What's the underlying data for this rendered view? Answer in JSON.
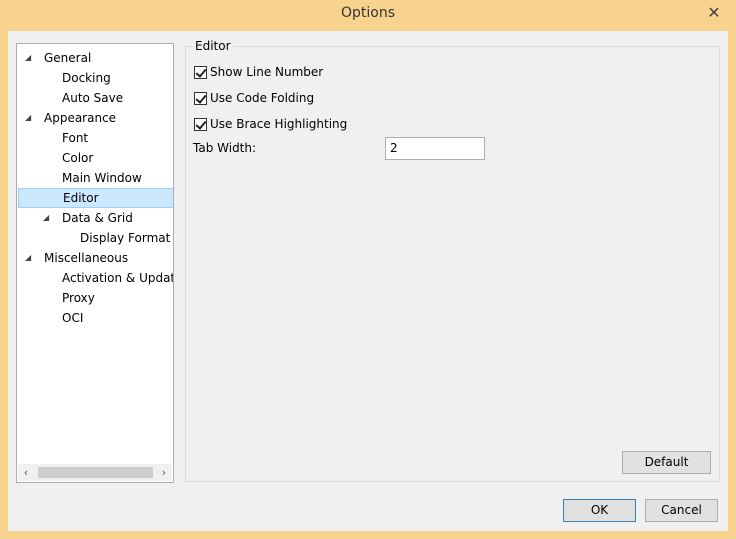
{
  "window": {
    "title": "Options"
  },
  "tree": {
    "items": [
      {
        "label": "General",
        "expanded": true,
        "level": 0
      },
      {
        "label": "Docking",
        "level": 1
      },
      {
        "label": "Auto Save",
        "level": 1
      },
      {
        "label": "Appearance",
        "expanded": true,
        "level": 0
      },
      {
        "label": "Font",
        "level": 1
      },
      {
        "label": "Color",
        "level": 1
      },
      {
        "label": "Main Window",
        "level": 1
      },
      {
        "label": "Editor",
        "level": 1,
        "selected": true
      },
      {
        "label": "Data & Grid",
        "expanded": true,
        "level": 1
      },
      {
        "label": "Display Format",
        "level": 2
      },
      {
        "label": "Miscellaneous",
        "expanded": true,
        "level": 0
      },
      {
        "label": "Activation & Updater",
        "level": 1
      },
      {
        "label": "Proxy",
        "level": 1
      },
      {
        "label": "OCI",
        "level": 1
      }
    ]
  },
  "editor": {
    "group_title": "Editor",
    "show_line_number": {
      "label": "Show Line Number",
      "checked": true
    },
    "use_code_folding": {
      "label": "Use Code Folding",
      "checked": true
    },
    "use_brace_highlighting": {
      "label": "Use Brace Highlighting",
      "checked": true
    },
    "tab_width": {
      "label": "Tab Width:",
      "value": "2"
    },
    "default_button": "Default"
  },
  "footer": {
    "ok": "OK",
    "cancel": "Cancel"
  }
}
